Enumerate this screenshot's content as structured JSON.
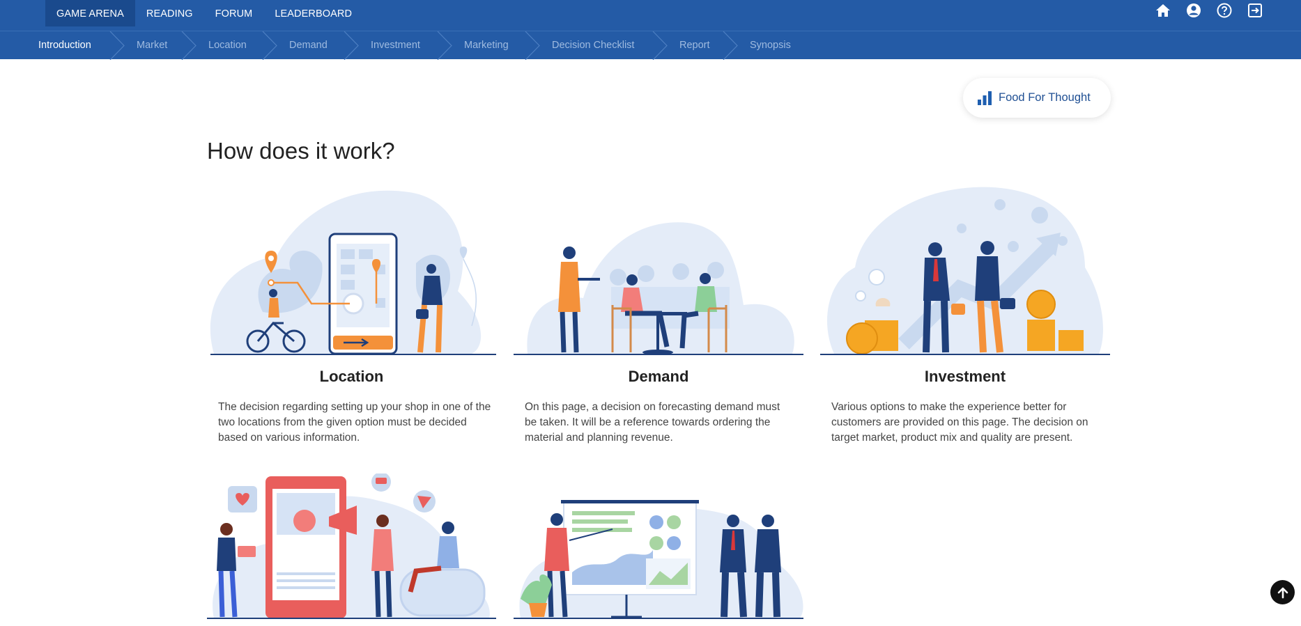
{
  "topnav": {
    "items": [
      {
        "label": "GAME ARENA"
      },
      {
        "label": "READING"
      },
      {
        "label": "FORUM"
      },
      {
        "label": "LEADERBOARD"
      }
    ],
    "icons": [
      "home-icon",
      "user-circle-icon",
      "help-icon",
      "logout-icon"
    ]
  },
  "steps": [
    {
      "label": "Introduction"
    },
    {
      "label": "Market"
    },
    {
      "label": "Location"
    },
    {
      "label": "Demand"
    },
    {
      "label": "Investment"
    },
    {
      "label": "Marketing"
    },
    {
      "label": "Decision Checklist"
    },
    {
      "label": "Report"
    },
    {
      "label": "Synopsis"
    }
  ],
  "food_for_thought": {
    "label": "Food For Thought",
    "icon": "bar-chart-icon"
  },
  "page_title": "How does it work?",
  "cards": [
    {
      "title": "Location",
      "description": "The decision regarding setting up your shop in one of the two locations from the given option must be decided based on various information."
    },
    {
      "title": "Demand",
      "description": "On this page, a decision on forecasting demand must be taken. It will be a reference towards ordering the material and planning revenue."
    },
    {
      "title": "Investment",
      "description": "Various options to make the experience better for customers are provided on this page. The decision on target market, product mix and quality are present."
    }
  ],
  "colors": {
    "nav": "#245ba6",
    "nav_active": "#1a4a8d",
    "accent_orange": "#f4913a",
    "navy": "#1f3f7a"
  }
}
